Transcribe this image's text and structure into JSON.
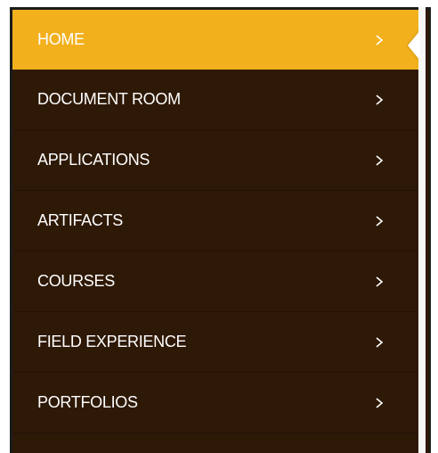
{
  "nav": {
    "items": [
      {
        "label": "HOME",
        "active": true,
        "icon": "chevron-right-icon"
      },
      {
        "label": "DOCUMENT ROOM",
        "active": false,
        "icon": "chevron-right-icon"
      },
      {
        "label": "APPLICATIONS",
        "active": false,
        "icon": "chevron-right-icon"
      },
      {
        "label": "ARTIFACTS",
        "active": false,
        "icon": "chevron-right-icon"
      },
      {
        "label": "COURSES",
        "active": false,
        "icon": "chevron-right-icon"
      },
      {
        "label": "FIELD EXPERIENCE",
        "active": false,
        "icon": "chevron-right-icon"
      },
      {
        "label": "PORTFOLIOS",
        "active": false,
        "icon": "chevron-right-icon"
      }
    ]
  },
  "colors": {
    "menu_background": "#2e1806",
    "active_background": "#f2b01d",
    "text": "#ffffff"
  }
}
